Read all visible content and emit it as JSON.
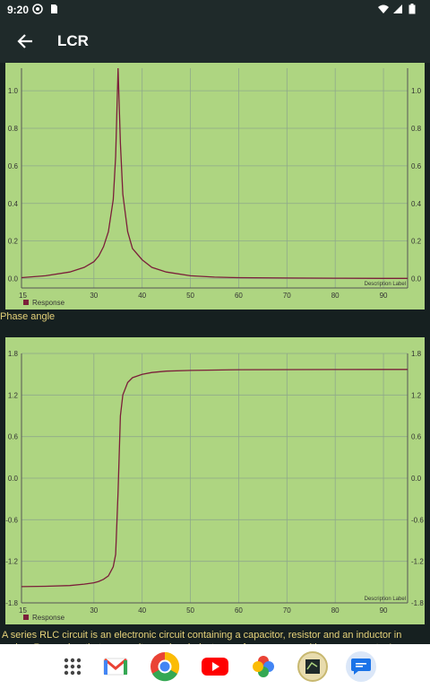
{
  "status": {
    "time": "9:20"
  },
  "app_bar": {
    "title": "LCR"
  },
  "chart1": {
    "description_label": "Description Label",
    "legend": "Response"
  },
  "caption2": "Phase angle",
  "chart2": {
    "description_label": "Description Label",
    "legend": "Response"
  },
  "description": "A series RLC circuit is an electronic circuit containing a capacitor, resistor and an inductor in series. Remember that a capacitor and an inductor are frequency sensitive components. In",
  "dock": [
    "apps-grid-icon",
    "gmail-icon",
    "chrome-icon",
    "youtube-icon",
    "photos-icon",
    "app-icon",
    "messages-icon"
  ],
  "colors": {
    "plot_bg": "#aed581",
    "line": "#7b1f3a",
    "accent_text": "#e6d27a"
  },
  "chart_data": [
    {
      "type": "line",
      "title": "",
      "xlabel": "",
      "ylabel": "",
      "x_ticks": [
        "15",
        "30",
        "40",
        "50",
        "60",
        "70",
        "80",
        "90"
      ],
      "y_ticks": [
        "1.0",
        "0.8",
        "0.6",
        "0.4",
        "0.2",
        "0.0"
      ],
      "xlim": [
        15,
        95
      ],
      "ylim": [
        -0.05,
        1.12
      ],
      "grid": true,
      "legend": "bottom-left",
      "series": [
        {
          "name": "Response",
          "x": [
            15,
            20,
            25,
            28,
            30,
            31,
            32,
            33,
            34,
            34.5,
            35,
            35.5,
            36,
            37,
            38,
            40,
            42,
            45,
            50,
            55,
            60,
            70,
            80,
            90,
            95
          ],
          "y": [
            0.005,
            0.015,
            0.035,
            0.06,
            0.09,
            0.12,
            0.17,
            0.25,
            0.42,
            0.65,
            1.12,
            0.72,
            0.45,
            0.25,
            0.16,
            0.1,
            0.06,
            0.035,
            0.015,
            0.008,
            0.005,
            0.003,
            0.002,
            0.001,
            0.001
          ]
        }
      ]
    },
    {
      "type": "line",
      "title": "",
      "xlabel": "",
      "ylabel": "",
      "x_ticks": [
        "15",
        "30",
        "40",
        "50",
        "60",
        "70",
        "80",
        "90"
      ],
      "y_ticks": [
        "1.8",
        "1.2",
        "0.6",
        "0.0",
        "-0.6",
        "-1.2",
        "-1.8"
      ],
      "xlim": [
        15,
        95
      ],
      "ylim": [
        -1.8,
        1.8
      ],
      "grid": true,
      "legend": "bottom-left",
      "series": [
        {
          "name": "Response",
          "x": [
            15,
            20,
            25,
            28,
            30,
            31,
            32,
            33,
            34,
            34.5,
            35,
            35.5,
            36,
            37,
            38,
            40,
            42,
            45,
            50,
            55,
            60,
            70,
            80,
            90,
            95
          ],
          "y": [
            -1.565,
            -1.56,
            -1.55,
            -1.53,
            -1.51,
            -1.49,
            -1.46,
            -1.41,
            -1.28,
            -1.1,
            -0.2,
            0.9,
            1.2,
            1.38,
            1.45,
            1.5,
            1.525,
            1.545,
            1.555,
            1.56,
            1.565,
            1.567,
            1.568,
            1.569,
            1.569
          ]
        }
      ]
    }
  ]
}
